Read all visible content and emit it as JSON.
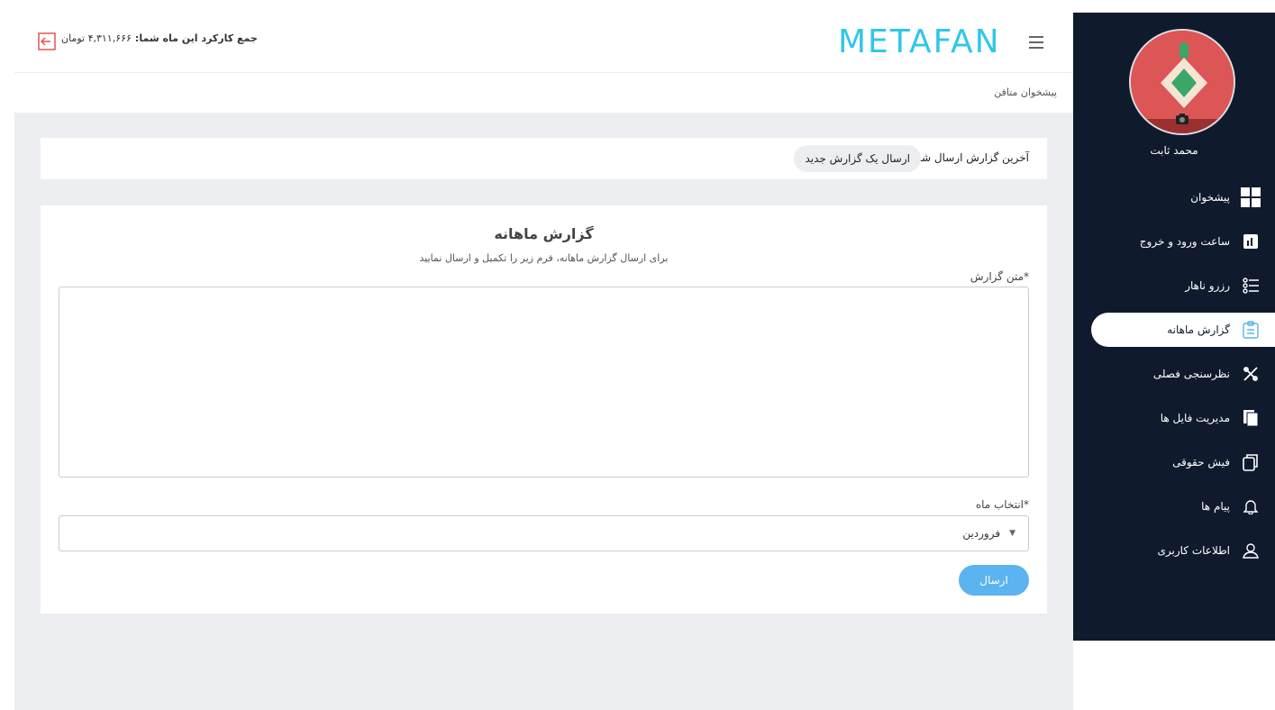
{
  "header": {
    "earnings_label": "جمع کارکرد این ماه شما:",
    "earnings_value": "۴,۳۱۱,۶۶۶ تومان"
  },
  "breadcrumb": "پیشخوان متافن",
  "logo_text": "METAFAN",
  "user": {
    "name": "محمد ثابت"
  },
  "sidebar": {
    "items": [
      {
        "label": "پیشخوان",
        "icon": "dashboard-icon"
      },
      {
        "label": "ساعت ورود و خروج",
        "icon": "chart-icon"
      },
      {
        "label": "رزرو ناهار",
        "icon": "list-icon"
      },
      {
        "label": "گزارش ماهانه",
        "icon": "clipboard-icon",
        "active": true
      },
      {
        "label": "نظرسنجی فصلی",
        "icon": "tools-icon"
      },
      {
        "label": "مدیریت فایل ها",
        "icon": "files-icon"
      },
      {
        "label": "فیش حقوقی",
        "icon": "copy-icon"
      },
      {
        "label": "پیام ها",
        "icon": "bell-icon"
      },
      {
        "label": "اطلاعات کاربری",
        "icon": "user-icon"
      }
    ]
  },
  "tabs": {
    "last": "آخرین گزارش ارسال شده",
    "new": "ارسال یک گزارش جدید"
  },
  "form": {
    "title": "گزارش ماهانه",
    "subtitle": "برای ارسال گزارش ماهانه، فرم زیر را تکمیل و ارسال نمایید",
    "text_label": "متن گزارش*",
    "month_label": "انتخاب ماه*",
    "month_value": "فروردین",
    "submit": "ارسال"
  },
  "colors": {
    "sidebar": "#101a2d",
    "accent": "#5bb4ef",
    "logo": "#2fc7e8"
  }
}
